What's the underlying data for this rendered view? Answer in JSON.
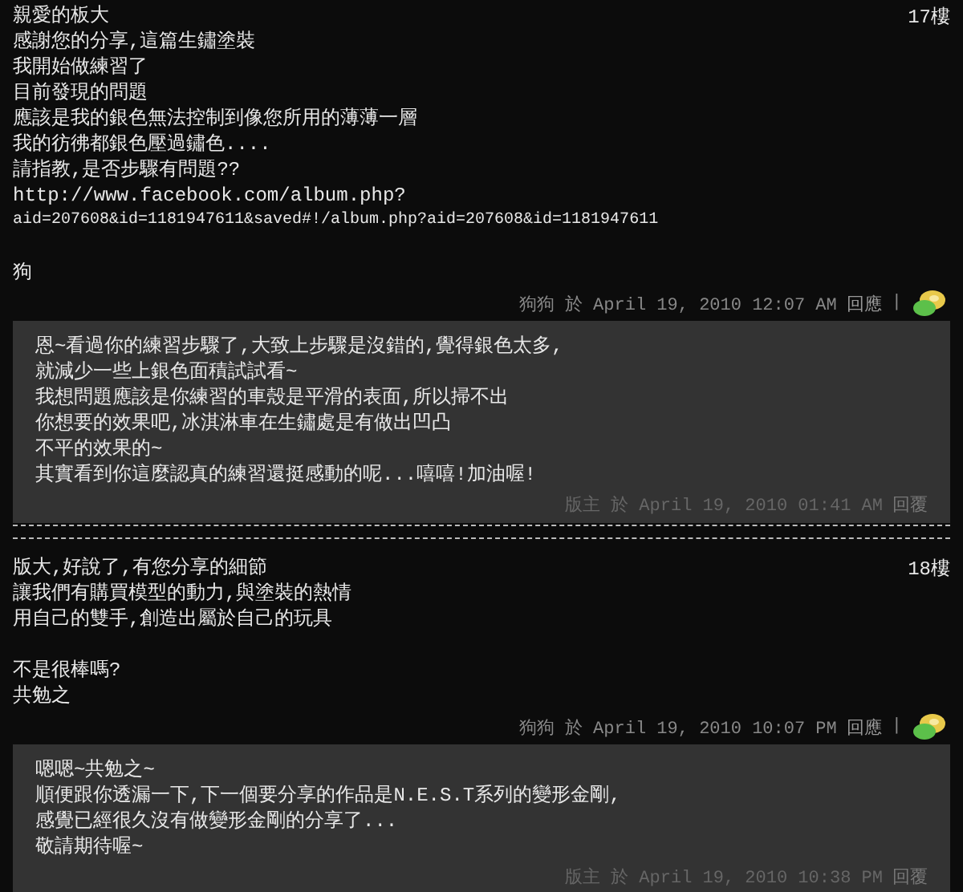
{
  "comments": [
    {
      "floor": "17樓",
      "paragraphs": [
        [
          "親愛的板大",
          "感謝您的分享,這篇生鏽塗裝",
          "我開始做練習了",
          "目前發現的問題",
          "應該是我的銀色無法控制到像您所用的薄薄一層",
          "我的彷彿都銀色壓過鏽色....",
          "請指教,是否步驟有問題??",
          "http://www.facebook.com/album.php?",
          "aid=207608&id=1181947611&saved#!/album.php?aid=207608&id=1181947611"
        ],
        [
          "狗"
        ]
      ],
      "meta": "狗狗 於 April 19, 2010 12:07 AM",
      "reply_link": "回應",
      "separator": "|",
      "reply": {
        "lines": [
          "恩~看過你的練習步驟了,大致上步驟是沒錯的,覺得銀色太多,",
          "就減少一些上銀色面積試試看~",
          "我想問題應該是你練習的車殼是平滑的表面,所以掃不出",
          "你想要的效果吧,冰淇淋車在生鏽處是有做出凹凸",
          "不平的效果的~",
          "其實看到你這麼認真的練習還挺感動的呢...嘻嘻!加油喔!"
        ],
        "meta": "版主 於 April 19, 2010 01:41 AM",
        "reply_link": "回覆"
      }
    },
    {
      "floor": "18樓",
      "paragraphs": [
        [
          "版大,好說了,有您分享的細節",
          "讓我們有購買模型的動力,與塗裝的熱情",
          "用自己的雙手,創造出屬於自己的玩具"
        ],
        [
          "不是很棒嗎?",
          "共勉之"
        ]
      ],
      "meta": "狗狗 於 April 19, 2010 10:07 PM",
      "reply_link": "回應",
      "separator": "|",
      "reply": {
        "lines": [
          "嗯嗯~共勉之~",
          "順便跟你透漏一下,下一個要分享的作品是N.E.S.T系列的變形金剛,",
          "感覺已經很久沒有做變形金剛的分享了...",
          "敬請期待喔~"
        ],
        "meta": "版主 於 April 19, 2010 10:38 PM",
        "reply_link": "回覆"
      }
    }
  ]
}
